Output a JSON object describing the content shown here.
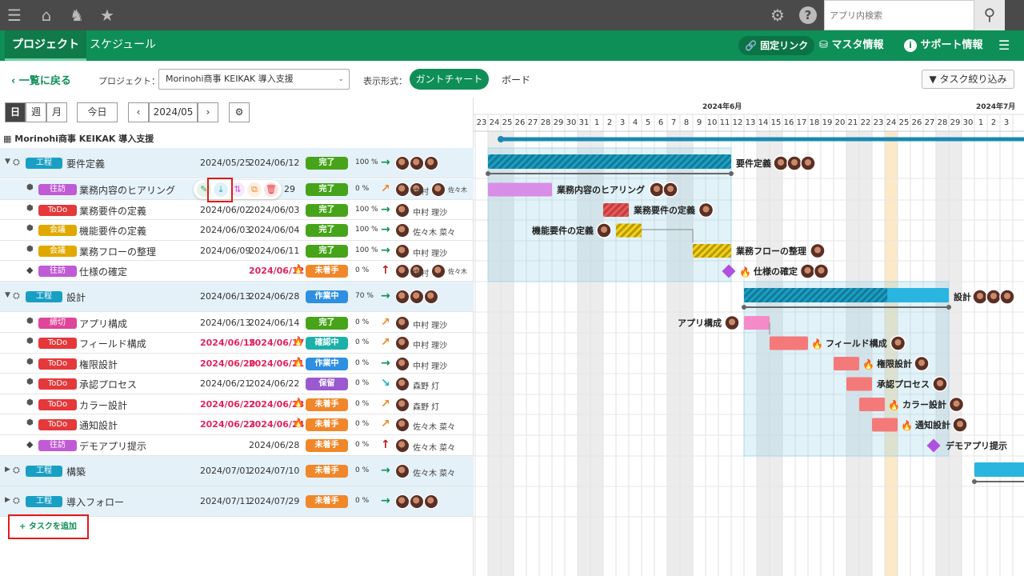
{
  "top": {
    "search_placeholder": "アプリ内検索"
  },
  "nav": {
    "tab_project": "プロジェクト",
    "tab_schedule": "スケジュール",
    "fixed_link": "固定リンク",
    "master_info": "マスタ情報",
    "support_info": "サポート情報"
  },
  "toolbar": {
    "back": "一覧に戻る",
    "project_label": "プロジェクト：",
    "project_value": "Morinohi商事 KEIKAK 導入支援",
    "display_label": "表示形式：",
    "gantt": "ガントチャート",
    "board": "ボード",
    "filter": "タスク絞り込み"
  },
  "controls": {
    "day": "日",
    "week": "週",
    "month": "月",
    "today": "今日",
    "month_value": "2024/05"
  },
  "project_name": "Morinohi商事 KEIKAK 導入支援",
  "add_task": "+ タスクを追加",
  "months": [
    "2024年6月",
    "2024年7月"
  ],
  "days": [
    "23",
    "24",
    "25",
    "26",
    "27",
    "28",
    "29",
    "30",
    "31",
    "1",
    "2",
    "3",
    "4",
    "5",
    "6",
    "7",
    "8",
    "9",
    "10",
    "11",
    "12",
    "13",
    "14",
    "15",
    "16",
    "17",
    "18",
    "19",
    "20",
    "21",
    "22",
    "23",
    "24",
    "25",
    "26",
    "27",
    "28",
    "29",
    "30",
    "1",
    "2",
    "3"
  ],
  "colors": {
    "green": "#0e8f57",
    "kotei": "#1a9fc4",
    "juritsu": "#c05bd6",
    "todo": "#e5383b",
    "kaigi": "#e0a800",
    "shime": "#e0459a",
    "done": "#47a41a",
    "working": "#2f8fe0",
    "review": "#1bb1a8",
    "hold": "#9b59d0",
    "notstart": "#f0872a",
    "overdue": "#e0245e"
  },
  "rows": [
    {
      "type": "group",
      "tag": "工程",
      "title": "要件定義",
      "start": "2024/05/25",
      "end": "2024/06/12",
      "status": "完了",
      "pct": "100 %",
      "arrow": "→",
      "arrow_color": "#0e8f57",
      "assignee": "",
      "avatars": 3,
      "bar": {
        "s": 1,
        "e": 20,
        "label": "要件定義",
        "av": 3,
        "style": "hatch",
        "color": "#1a9fc4"
      }
    },
    {
      "type": "task",
      "tag": "往訪",
      "title": "業務内容のヒアリング",
      "start": "",
      "end": "29",
      "status": "完了",
      "pct": "0 %",
      "arrow": "↗",
      "arrow_color": "#f0872a",
      "assignee": "中村",
      "assignee2": "佐々木",
      "avatars": 2,
      "hl": true,
      "bar": {
        "s": 1,
        "e": 6,
        "label": "業務内容のヒアリング",
        "av": 2,
        "style": "solid",
        "color": "#d88ee6"
      }
    },
    {
      "type": "task",
      "tag": "ToDo",
      "title": "業務要件の定義",
      "start": "2024/06/02",
      "end": "2024/06/03",
      "status": "完了",
      "pct": "100 %",
      "arrow": "→",
      "arrow_color": "#0e8f57",
      "assignee": "中村 理沙",
      "avatars": 1,
      "bar": {
        "s": 10,
        "e": 12,
        "label": "業務要件の定義",
        "av": 1,
        "style": "hatchred",
        "color": "#e55b5b"
      }
    },
    {
      "type": "task",
      "tag": "会議",
      "title": "機能要件の定義",
      "start": "2024/06/03",
      "end": "2024/06/04",
      "status": "完了",
      "pct": "100 %",
      "arrow": "→",
      "arrow_color": "#0e8f57",
      "assignee": "佐々木 菜々",
      "avatars": 1,
      "bar": {
        "s": 11,
        "e": 13,
        "label": "機能要件の定義",
        "av": 1,
        "style": "hatchyellow",
        "color": "#e5c20a",
        "left": true
      }
    },
    {
      "type": "task",
      "tag": "会議",
      "title": "業務フローの整理",
      "start": "2024/06/09",
      "end": "2024/06/11",
      "status": "完了",
      "pct": "100 %",
      "arrow": "→",
      "arrow_color": "#0e8f57",
      "assignee": "中村 理沙",
      "avatars": 1,
      "bar": {
        "s": 17,
        "e": 20,
        "label": "業務フローの整理",
        "av": 1,
        "style": "hatchyellow",
        "color": "#e5c20a"
      }
    },
    {
      "type": "milestone",
      "tag": "往訪",
      "title": "仕様の確定",
      "start": "",
      "end": "2024/06/12",
      "end_overdue": true,
      "status": "未着手",
      "pct": "0 %",
      "arrow": "↑",
      "arrow_color": "#b52020",
      "assignee": "中村",
      "assignee2": "佐々木",
      "avatars": 2,
      "bar": {
        "s": 20,
        "e": 20,
        "label": "仕様の確定",
        "av": 2,
        "style": "diamond",
        "fire": true
      }
    },
    {
      "type": "group",
      "tag": "工程",
      "title": "設計",
      "start": "2024/06/13",
      "end": "2024/06/28",
      "status": "作業中",
      "pct": "70 %",
      "arrow": "→",
      "arrow_color": "#0e8f57",
      "assignee": "",
      "avatars": 3,
      "bar": {
        "s": 21,
        "e": 37,
        "label": "設計",
        "av": 3,
        "style": "progress",
        "color": "#2ab4e0",
        "progress": 0.7
      }
    },
    {
      "type": "task",
      "tag": "締切",
      "title": "アプリ構成",
      "start": "2024/06/13",
      "end": "2024/06/14",
      "status": "完了",
      "pct": "0 %",
      "arrow": "↗",
      "arrow_color": "#f0872a",
      "assignee": "中村 理沙",
      "avatars": 1,
      "bar": {
        "s": 21,
        "e": 23,
        "label": "アプリ構成",
        "av": 1,
        "style": "solid",
        "color": "#f58ac8",
        "left": true
      }
    },
    {
      "type": "task",
      "tag": "ToDo",
      "title": "フィールド構成",
      "start": "2024/06/15",
      "end": "2024/06/17",
      "start_overdue": true,
      "end_overdue": true,
      "status": "確認中",
      "pct": "0 %",
      "arrow": "↗",
      "arrow_color": "#f0872a",
      "assignee": "中村 理沙",
      "avatars": 1,
      "bar": {
        "s": 23,
        "e": 26,
        "label": "フィールド構成",
        "av": 1,
        "style": "solid",
        "color": "#f47a7a",
        "fire": true
      }
    },
    {
      "type": "task",
      "tag": "ToDo",
      "title": "権限設計",
      "start": "2024/06/20",
      "end": "2024/06/21",
      "start_overdue": true,
      "end_overdue": true,
      "status": "作業中",
      "pct": "0 %",
      "arrow": "→",
      "arrow_color": "#0e8f57",
      "assignee": "中村 理沙",
      "avatars": 1,
      "bar": {
        "s": 28,
        "e": 30,
        "label": "権限設計",
        "av": 1,
        "style": "solid",
        "color": "#f47a7a",
        "fire": true
      }
    },
    {
      "type": "task",
      "tag": "ToDo",
      "title": "承認プロセス",
      "start": "2024/06/21",
      "end": "2024/06/22",
      "status": "保留",
      "pct": "0 %",
      "arrow": "↘",
      "arrow_color": "#1bb1c4",
      "assignee": "森野 灯",
      "avatars": 1,
      "bar": {
        "s": 29,
        "e": 31,
        "label": "承認プロセス",
        "av": 1,
        "style": "solid",
        "color": "#f47a7a"
      }
    },
    {
      "type": "task",
      "tag": "ToDo",
      "title": "カラー設計",
      "start": "2024/06/22",
      "end": "2024/06/23",
      "start_overdue": true,
      "end_overdue": true,
      "status": "未着手",
      "pct": "0 %",
      "arrow": "↗",
      "arrow_color": "#f0872a",
      "assignee": "森野 灯",
      "avatars": 1,
      "bar": {
        "s": 30,
        "e": 32,
        "label": "カラー設計",
        "av": 1,
        "style": "solid",
        "color": "#f47a7a",
        "fire": true
      }
    },
    {
      "type": "task",
      "tag": "ToDo",
      "title": "通知設計",
      "start": "2024/06/23",
      "end": "2024/06/24",
      "start_overdue": true,
      "end_overdue": true,
      "status": "未着手",
      "pct": "0 %",
      "arrow": "↗",
      "arrow_color": "#f0872a",
      "assignee": "佐々木 菜々",
      "avatars": 1,
      "bar": {
        "s": 31,
        "e": 33,
        "label": "通知設計",
        "av": 1,
        "style": "solid",
        "color": "#f47a7a",
        "fire": true
      }
    },
    {
      "type": "milestone",
      "tag": "往訪",
      "title": "デモアプリ提示",
      "start": "",
      "end": "2024/06/28",
      "status": "未着手",
      "pct": "0 %",
      "arrow": "↑",
      "arrow_color": "#b52020",
      "assignee": "佐々木 菜々",
      "avatars": 1,
      "bar": {
        "s": 36,
        "e": 36,
        "label": "デモアプリ提示",
        "av": 0,
        "style": "diamond"
      }
    },
    {
      "type": "group",
      "tag": "工程",
      "title": "構築",
      "start": "2024/07/01",
      "end": "2024/07/10",
      "status": "未着手",
      "pct": "0 %",
      "arrow": "→",
      "arrow_color": "#0e8f57",
      "assignee": "佐々木 菜々",
      "avatars": 1,
      "collapsed": true,
      "bar": {
        "s": 39,
        "e": 48,
        "label": "",
        "av": 0,
        "style": "solid",
        "color": "#2ab4e0"
      }
    },
    {
      "type": "group",
      "tag": "工程",
      "title": "導入フォロー",
      "start": "2024/07/11",
      "end": "2024/07/29",
      "status": "未着手",
      "pct": "0 %",
      "arrow": "→",
      "arrow_color": "#0e8f57",
      "assignee": "",
      "avatars": 3,
      "collapsed": true
    }
  ]
}
